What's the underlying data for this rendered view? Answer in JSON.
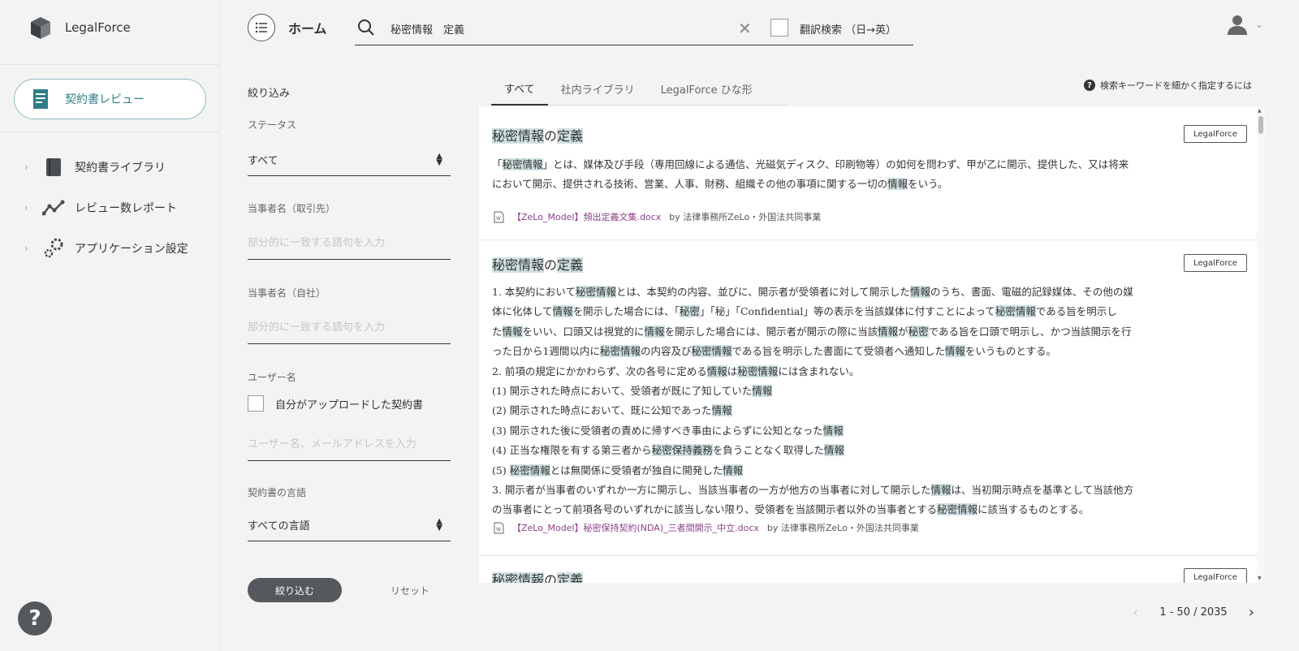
{
  "sidebar": {
    "brand": "LegalForce",
    "review_button": "契約書レビュー",
    "nav": [
      {
        "label": "契約書ライブラリ",
        "icon": "book-icon"
      },
      {
        "label": "レビュー数レポート",
        "icon": "chart-line-icon"
      },
      {
        "label": "アプリケーション設定",
        "icon": "gear-icon"
      }
    ],
    "help": "?"
  },
  "header": {
    "title": "ホーム",
    "search_value": "秘密情報　定義",
    "clear": "✕",
    "translate_label": "翻訳検索 （日→英）"
  },
  "filter": {
    "title": "絞り込み",
    "status_label": "ステータス",
    "status_value": "すべて",
    "party_client_label": "当事者名（取引先）",
    "party_client_placeholder": "部分的に一致する語句を入力",
    "party_own_label": "当事者名（自社）",
    "party_own_placeholder": "部分的に一致する語句を入力",
    "user_label": "ユーザー名",
    "own_upload_label": "自分がアップロードした契約書",
    "user_placeholder": "ユーザー名、メールアドレスを入力",
    "language_label": "契約書の言語",
    "language_value": "すべての言語",
    "apply": "絞り込む",
    "reset": "リセット"
  },
  "tabs": [
    "すべて",
    "社内ライブラリ",
    "LegalForce ひな形"
  ],
  "tips": "検索キーワードを細かく指定するには",
  "results": [
    {
      "title": [
        {
          "t": "秘密情報",
          "h": true
        },
        {
          "t": "の"
        },
        {
          "t": "定義",
          "h": true
        }
      ],
      "badge": "LegalForce",
      "lines": [
        [
          {
            "t": "「"
          },
          {
            "t": "秘密情報",
            "h": true
          },
          {
            "t": "」とは、媒体及び手段（専用回線による通信、光磁気ディスク、印刷物等）の如何を問わず、甲が乙に開示、提供した、又は将来"
          }
        ],
        [
          {
            "t": "において開示、提供される技術、営業、人事、財務、組織その他の事項に関する一切の"
          },
          {
            "t": "情報",
            "h": true
          },
          {
            "t": "をいう。"
          }
        ]
      ],
      "file": "【ZeLo_Model】頻出定義文集.docx",
      "org": "by 法律事務所ZeLo・外国法共同事業"
    },
    {
      "title": [
        {
          "t": "秘密情報",
          "h": true
        },
        {
          "t": "の"
        },
        {
          "t": "定義",
          "h": true
        }
      ],
      "badge": "LegalForce",
      "lines": [
        [
          {
            "t": "1. 本契約において"
          },
          {
            "t": "秘密情報",
            "h": true
          },
          {
            "t": "とは、本契約の内容、並びに、開示者が受領者に対して開示した"
          },
          {
            "t": "情報",
            "h": true
          },
          {
            "t": "のうち、書面、電磁的記録媒体、その他の媒"
          }
        ],
        [
          {
            "t": "体に化体して"
          },
          {
            "t": "情報",
            "h": true
          },
          {
            "t": "を開示した場合には、「"
          },
          {
            "t": "秘密",
            "h": true
          },
          {
            "t": "」「秘」「Confidential」等の表示を当該媒体に付すことによって"
          },
          {
            "t": "秘密情報",
            "h": true
          },
          {
            "t": "である旨を明示し"
          }
        ],
        [
          {
            "t": "た"
          },
          {
            "t": "情報",
            "h": true
          },
          {
            "t": "をいい、口頭又は視覚的に"
          },
          {
            "t": "情報",
            "h": true
          },
          {
            "t": "を開示した場合には、開示者が開示の際に当該"
          },
          {
            "t": "情報",
            "h": true
          },
          {
            "t": "が"
          },
          {
            "t": "秘密",
            "h": true
          },
          {
            "t": "である旨を口頭で明示し、かつ当該開示を行"
          }
        ],
        [
          {
            "t": "った日から1週間以内に"
          },
          {
            "t": "秘密情報",
            "h": true
          },
          {
            "t": "の内容及び"
          },
          {
            "t": "秘密情報",
            "h": true
          },
          {
            "t": "である旨を明示した書面にて受領者へ通知した"
          },
          {
            "t": "情報",
            "h": true
          },
          {
            "t": "をいうものとする。"
          }
        ],
        [
          {
            "t": "2. 前項の規定にかかわらず、次の各号に定める"
          },
          {
            "t": "情報",
            "h": true
          },
          {
            "t": "は"
          },
          {
            "t": "秘密情報",
            "h": true
          },
          {
            "t": "には含まれない。"
          }
        ],
        [
          {
            "t": "(1) 開示された時点において、受領者が既に了知していた"
          },
          {
            "t": "情報",
            "h": true
          }
        ],
        [
          {
            "t": "(2) 開示された時点において、既に公知であった"
          },
          {
            "t": "情報",
            "h": true
          }
        ],
        [
          {
            "t": "(3) 開示された後に受領者の責めに帰すべき事由によらずに公知となった"
          },
          {
            "t": "情報",
            "h": true
          }
        ],
        [
          {
            "t": "(4) 正当な権限を有する第三者から"
          },
          {
            "t": "秘密保持義務",
            "h": true
          },
          {
            "t": "を負うことなく取得した"
          },
          {
            "t": "情報",
            "h": true
          }
        ],
        [
          {
            "t": "(5) "
          },
          {
            "t": "秘密情報",
            "h": true
          },
          {
            "t": "とは無関係に受領者が独自に開発した"
          },
          {
            "t": "情報",
            "h": true
          }
        ],
        [
          {
            "t": "3. 開示者が当事者のいずれか一方に開示し、当該当事者の一方が他方の当事者に対して開示した"
          },
          {
            "t": "情報",
            "h": true
          },
          {
            "t": "は、当初開示時点を基準として当該他方"
          }
        ],
        [
          {
            "t": "の当事者にとって前項各号のいずれかに該当しない限り、受領者を当該開示者以外の当事者とする"
          },
          {
            "t": "秘密情報",
            "h": true
          },
          {
            "t": "に該当するものとする。"
          }
        ]
      ],
      "file": "【ZeLo_Model】秘密保持契約(NDA)_三者間開示_中立.docx",
      "org": "by 法律事務所ZeLo・外国法共同事業"
    },
    {
      "title": [
        {
          "t": "秘密情報",
          "h": true
        },
        {
          "t": "の"
        },
        {
          "t": "定義",
          "h": true
        }
      ],
      "badge": "LegalForce",
      "lines": [],
      "file": "",
      "org": ""
    }
  ],
  "pager": {
    "range": "1 - 50 / 2035"
  },
  "colors": {
    "accent": "#2f7d86",
    "highlight": "#cfe0e2",
    "file_link": "#8c3f8c",
    "dark_button": "#55585c"
  }
}
